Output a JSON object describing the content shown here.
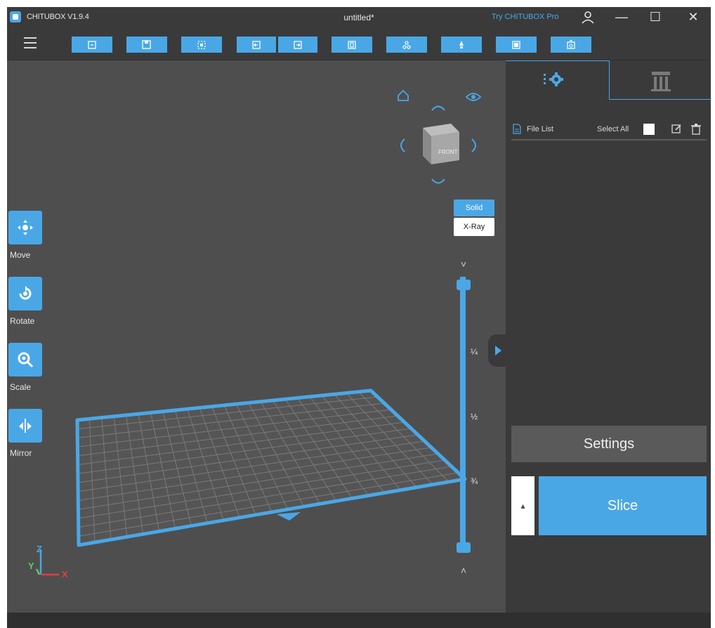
{
  "titlebar": {
    "app_name": "CHITUBOX V1.9.4",
    "doc_title": "untitled*",
    "try_pro": "Try CHITUBOX Pro",
    "user_icon": "user-icon",
    "minimize_icon": "minimize-icon",
    "maximize_icon": "maximize-icon",
    "close_icon": "close-icon",
    "minimize_glyph": "—",
    "maximize_glyph": "☐",
    "close_glyph": "✕"
  },
  "toolbar": {
    "menu_icon": "hamburger-menu-icon",
    "buttons": [
      {
        "name": "open-file-button",
        "icon": "open-file-icon"
      },
      {
        "name": "save-file-button",
        "icon": "save-icon"
      },
      {
        "name": "zoom-fit-button",
        "icon": "zoom-fit-icon"
      },
      {
        "name": "undo-button",
        "icon": "undo-icon"
      },
      {
        "name": "redo-button",
        "icon": "redo-icon"
      },
      {
        "name": "layout-button",
        "icon": "layout-icon"
      },
      {
        "name": "hollow-button",
        "icon": "hollow-icon"
      },
      {
        "name": "drill-button",
        "icon": "drill-icon"
      },
      {
        "name": "platform-button",
        "icon": "platform-icon"
      },
      {
        "name": "machine-settings-button",
        "icon": "machine-icon"
      }
    ]
  },
  "tools": [
    {
      "name": "move",
      "label": "Move",
      "icon": "move-icon"
    },
    {
      "name": "rotate",
      "label": "Rotate",
      "icon": "rotate-icon"
    },
    {
      "name": "scale",
      "label": "Scale",
      "icon": "scale-icon"
    },
    {
      "name": "mirror",
      "label": "Mirror",
      "icon": "mirror-icon"
    }
  ],
  "view": {
    "cube_face": "FRONT",
    "solid": "Solid",
    "xray": "X-Ray"
  },
  "slider": {
    "marks": [
      "¼",
      "½",
      "¾"
    ],
    "up_glyph": "˄",
    "down_glyph": "˅"
  },
  "axes": {
    "z": "Z",
    "y": "Y",
    "x": "X"
  },
  "panel": {
    "file_list": "File List",
    "select_all": "Select All",
    "settings": "Settings",
    "slice": "Slice",
    "slice_drop": "▴"
  },
  "colors": {
    "accent": "#4aa7e6",
    "background": "#4e4e4e",
    "panel": "#3a3a3a"
  }
}
